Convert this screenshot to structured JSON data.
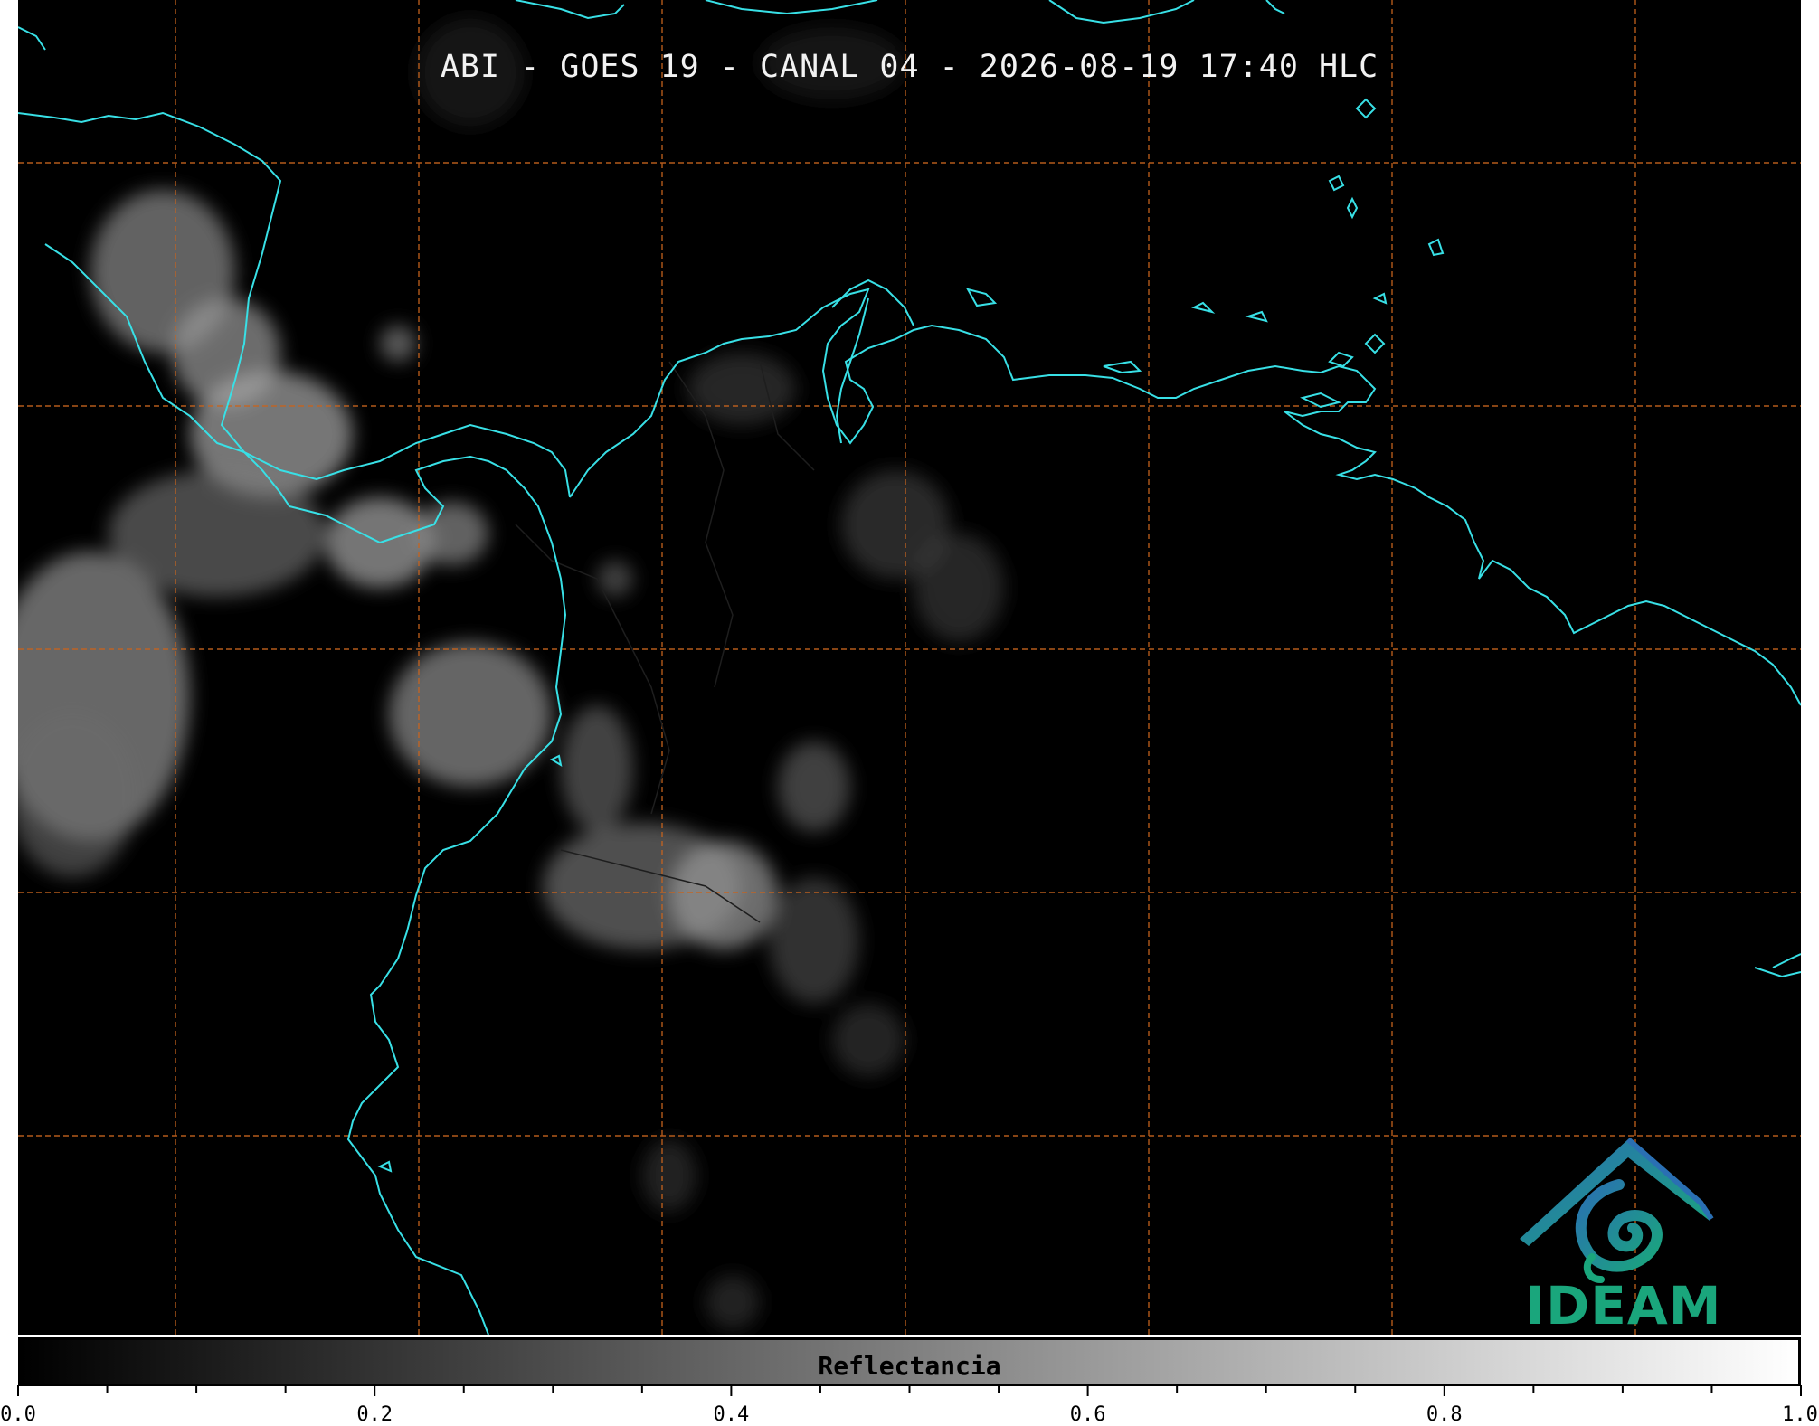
{
  "title": "ABI - GOES 19 - CANAL 04 - 2026-08-19 17:40 HLC",
  "logo": {
    "text": "IDEAM",
    "brand_color": "#1aa67c"
  },
  "colorbar": {
    "label": "Reflectancia",
    "min": 0.0,
    "max": 1.0,
    "major_tick_step": 0.2,
    "minor_tick_step": 0.05,
    "tick_labels": [
      "0.0",
      "0.2",
      "0.4",
      "0.6",
      "0.8",
      "1.0"
    ]
  },
  "colors": {
    "coastline": "#38e0e6",
    "gridlines": "#c8641e",
    "borders": "#222222",
    "background": "#000000"
  },
  "map": {
    "gridlines": true,
    "gridline_style": "dashed",
    "imagery": "grayscale visible reflectance"
  }
}
